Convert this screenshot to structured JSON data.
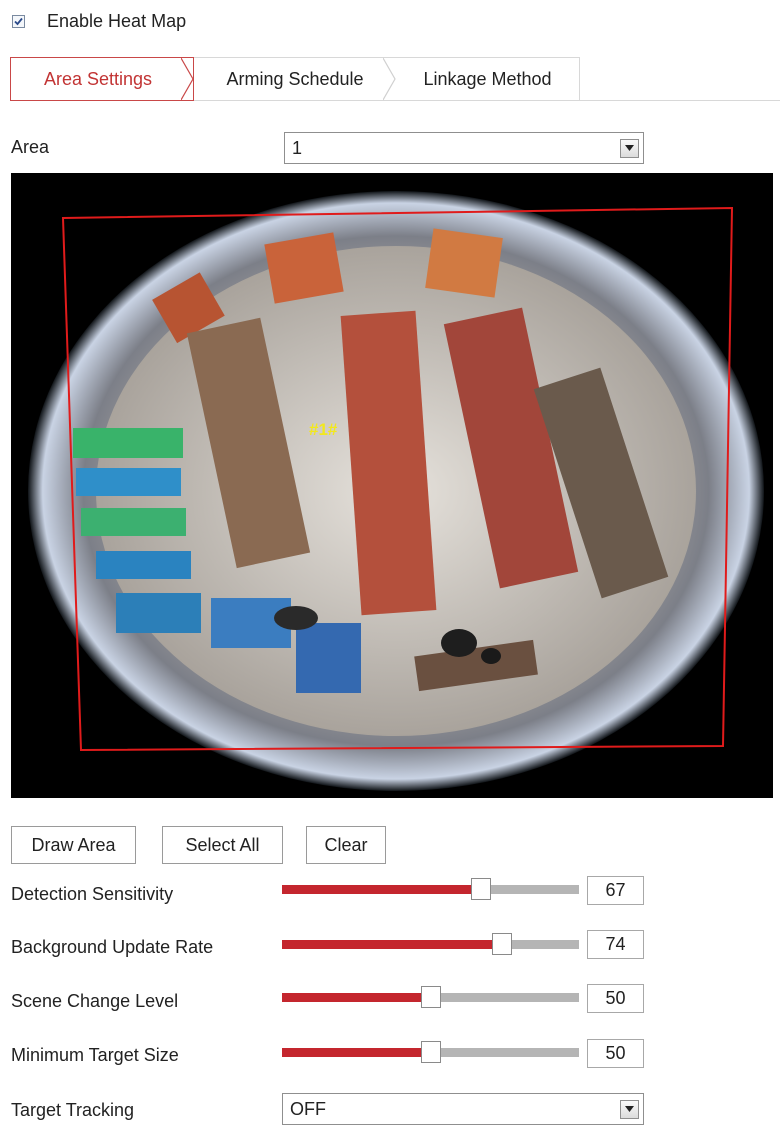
{
  "enable_heat_map": {
    "label": "Enable Heat Map",
    "checked": true
  },
  "tabs": [
    {
      "label": "Area Settings",
      "active": true
    },
    {
      "label": "Arming Schedule",
      "active": false
    },
    {
      "label": "Linkage Method",
      "active": false
    }
  ],
  "area": {
    "label": "Area",
    "value": "1"
  },
  "video": {
    "area_tag": "#1#"
  },
  "buttons": {
    "draw": "Draw Area",
    "select_all": "Select All",
    "clear": "Clear"
  },
  "sliders": [
    {
      "label": "Detection Sensitivity",
      "value": "67",
      "fraction": 0.67
    },
    {
      "label": "Background Update Rate",
      "value": "74",
      "fraction": 0.74
    },
    {
      "label": "Scene Change Level",
      "value": "50",
      "fraction": 0.5
    },
    {
      "label": "Minimum Target Size",
      "value": "50",
      "fraction": 0.5
    }
  ],
  "target_tracking": {
    "label": "Target Tracking",
    "value": "OFF"
  },
  "colors": {
    "accent": "#c4262e",
    "area_outline": "#e01b1b",
    "tab_active": "#c23434"
  }
}
